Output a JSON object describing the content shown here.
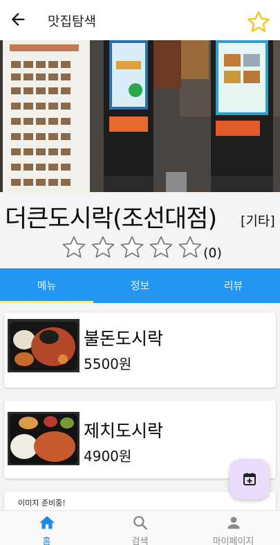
{
  "appbar": {
    "title": "맛집탐색",
    "back_icon": "arrow-left-icon",
    "favorite_icon": "star-outline-icon",
    "favorite_color": "#f5c518"
  },
  "store": {
    "name": "더큰도시락(조선대점)",
    "category": "[기타]",
    "rating_stars": 0,
    "rating_max": 5,
    "review_count": "(0)"
  },
  "tabs": [
    {
      "label": "메뉴",
      "active": true
    },
    {
      "label": "정보",
      "active": false
    },
    {
      "label": "리뷰",
      "active": false
    }
  ],
  "menu": [
    {
      "name": "불돈도시락",
      "price": "5500원"
    },
    {
      "name": "제치도시락",
      "price": "4900원"
    }
  ],
  "partial_card": {
    "placeholder": "이미지 준비중!"
  },
  "fab": {
    "icon": "calendar-add-icon"
  },
  "bottom_nav": [
    {
      "label": "홈",
      "icon": "home-icon",
      "active": true
    },
    {
      "label": "검색",
      "icon": "search-icon",
      "active": false
    },
    {
      "label": "마이페이지",
      "icon": "person-icon",
      "active": false
    }
  ],
  "colors": {
    "tab_bar": "#2196f3",
    "tab_indicator": "#eef08a",
    "nav_active": "#1e88e5",
    "fab_bg": "#eadcfb"
  }
}
